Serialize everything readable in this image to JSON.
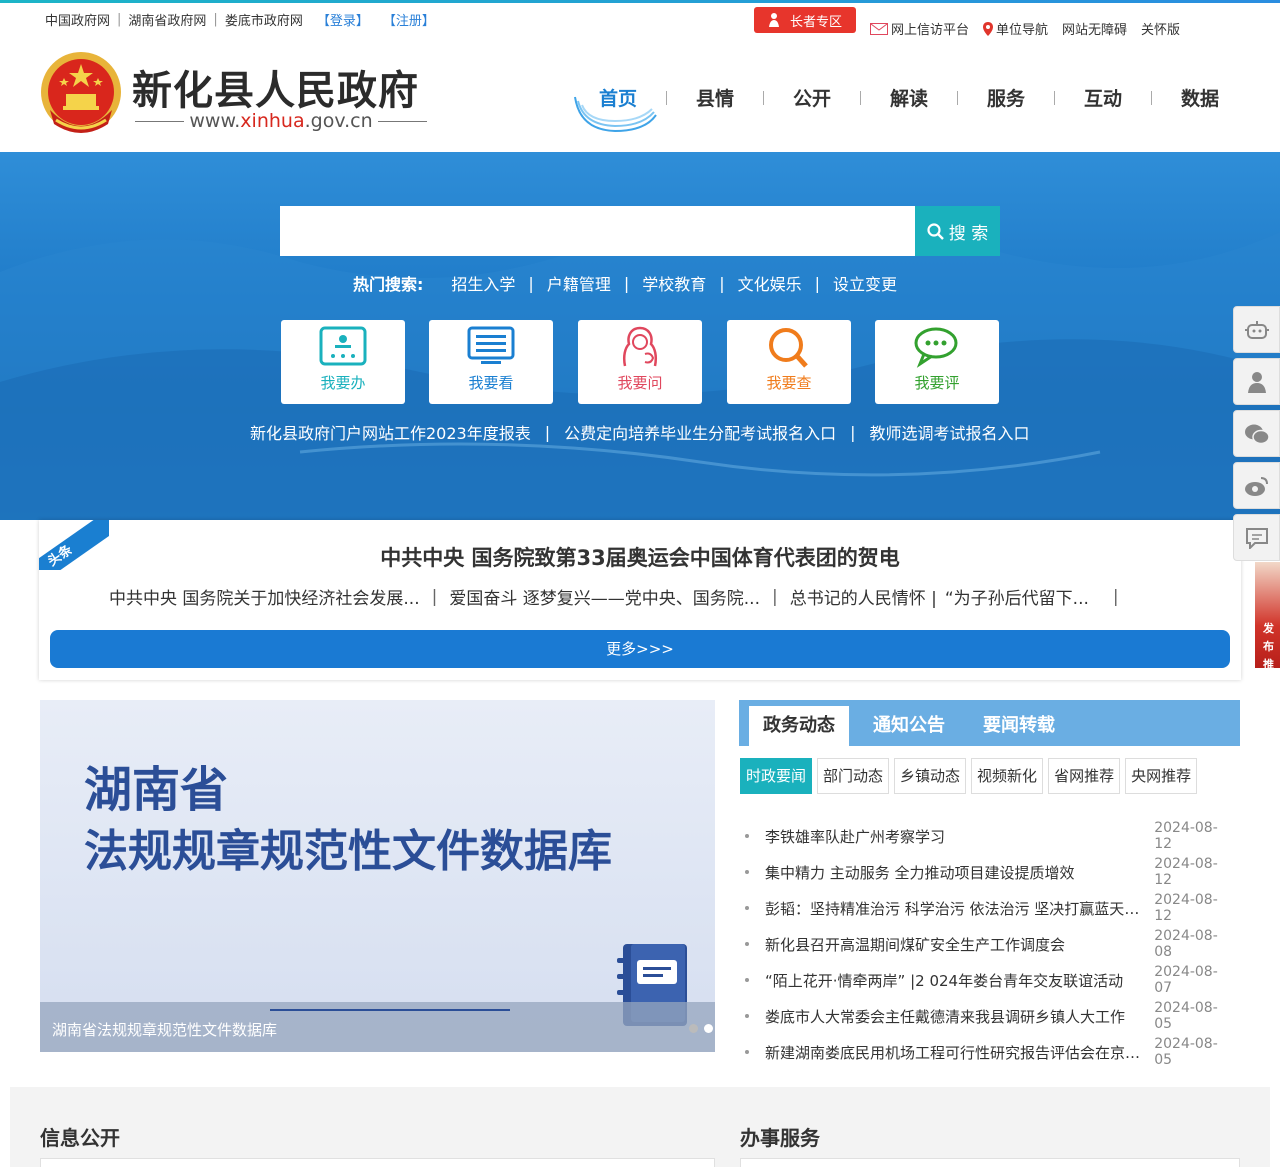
{
  "top": {
    "links": [
      "中国政府网",
      "湖南省政府网",
      "娄底市政府网"
    ],
    "login": "【登录】",
    "register": "【注册】",
    "elder_zone": "长者专区",
    "right_links": [
      "网上信访平台",
      "单位导航",
      "网站无障碍",
      "关怀版"
    ]
  },
  "header": {
    "title": "新化县人民政府",
    "url_prefix": "www.",
    "url_highlight": "xinhua",
    "url_suffix": ".gov.cn"
  },
  "nav": {
    "items": [
      "首页",
      "县情",
      "公开",
      "解读",
      "服务",
      "互动",
      "数据"
    ],
    "active": "首页"
  },
  "search": {
    "placeholder": "",
    "button": "搜 索",
    "hot_label": "热门搜索:",
    "hot_terms": [
      "招生入学",
      "户籍管理",
      "学校教育",
      "文化娱乐",
      "设立变更"
    ]
  },
  "quick": [
    {
      "label": "我要办",
      "color": "#1ab1bd"
    },
    {
      "label": "我要看",
      "color": "#1a7fd1"
    },
    {
      "label": "我要问",
      "color": "#e0475d"
    },
    {
      "label": "我要查",
      "color": "#f07c1c"
    },
    {
      "label": "我要评",
      "color": "#33a12f"
    }
  ],
  "banner_links": [
    "新化县政府门户网站工作2023年度报表",
    "公费定向培养毕业生分配考试报名入口",
    "教师选调考试报名入口"
  ],
  "headline": {
    "tag": "头条",
    "title": "中共中央 国务院致第33届奥运会中国体育代表团的贺电",
    "subs": [
      "中共中央 国务院关于加快经济社会发展...",
      "爱国奋斗 逐梦复兴——党中央、国务院...",
      "总书记的人民情怀 |",
      "“为子孙后代留下..."
    ],
    "more": "更多>>>"
  },
  "side_ad": "发布推动",
  "slider": {
    "big1": "湖南省",
    "big2": "法规规章规范性文件数据库",
    "caption": "湖南省法规规章规范性文件数据库",
    "dot_count": 4,
    "active_dot": 2
  },
  "news": {
    "tabs": [
      "政务动态",
      "通知公告",
      "要闻转载"
    ],
    "active_tab": "政务动态",
    "subtabs": [
      "时政要闻",
      "部门动态",
      "乡镇动态",
      "视频新化",
      "省网推荐",
      "央网推荐"
    ],
    "active_subtab": "时政要闻",
    "items": [
      {
        "title": "李铁雄率队赴广州考察学习",
        "date": "2024-08-12"
      },
      {
        "title": "集中精力 主动服务 全力推动项目建设提质增效",
        "date": "2024-08-12"
      },
      {
        "title": "彭韬：坚持精准治污 科学治污 依法治污 坚决打赢蓝天碧水净土保卫战",
        "date": "2024-08-12"
      },
      {
        "title": "新化县召开高温期间煤矿安全生产工作调度会",
        "date": "2024-08-08"
      },
      {
        "title": "“陌上花开·情牵两岸” |2 024年娄台青年交友联谊活动",
        "date": "2024-08-07"
      },
      {
        "title": "娄底市人大常委会主任戴德清来我县调研乡镇人大工作",
        "date": "2024-08-05"
      },
      {
        "title": "新建湖南娄底民用机场工程可行性研究报告评估会在京召开",
        "date": "2024-08-05"
      }
    ]
  },
  "sections": {
    "left": "信息公开",
    "right": "办事服务"
  }
}
